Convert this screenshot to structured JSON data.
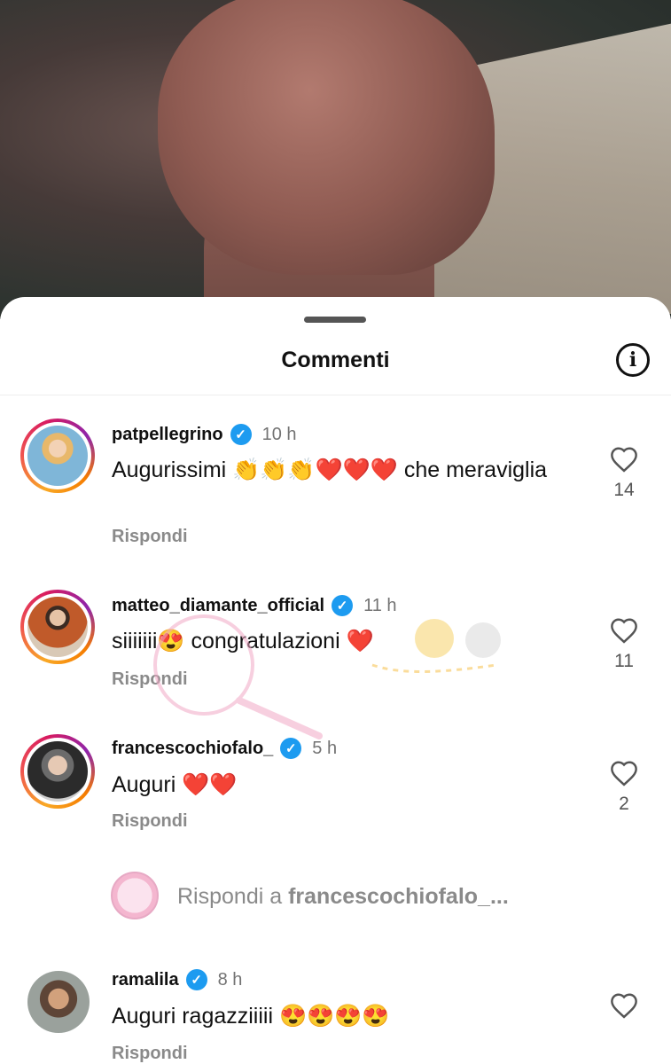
{
  "sheet": {
    "title": "Commenti"
  },
  "comments": [
    {
      "username": "patpellegrino",
      "time": "10 h",
      "text": "Augurissimi 👏👏👏❤️❤️❤️ che meraviglia",
      "reply_label": "Rispondi",
      "likes": "14"
    },
    {
      "username": "matteo_diamante_official",
      "time": "11 h",
      "text": "siiiiiii😍 congratulazioni ❤️",
      "reply_label": "Rispondi",
      "likes": "11"
    },
    {
      "username": "francescochiofalo_",
      "time": "5 h",
      "text": "Auguri ❤️❤️",
      "reply_label": "Rispondi",
      "likes": "2"
    },
    {
      "username": "ramalila",
      "time": "8 h",
      "text": "Auguri ragazziiiii 😍😍😍😍",
      "reply_label": "Rispondi"
    }
  ],
  "reply_composer": {
    "prefix": "Rispondi a",
    "target": "francescochiofalo_..."
  },
  "icons": {
    "info": "info-icon",
    "like": "heart-outline-icon",
    "verified": "verified-badge-icon"
  },
  "colors": {
    "verified_blue": "#1d9bf0",
    "muted_text": "#8a8a8a",
    "heart_red": "#e0245e"
  }
}
